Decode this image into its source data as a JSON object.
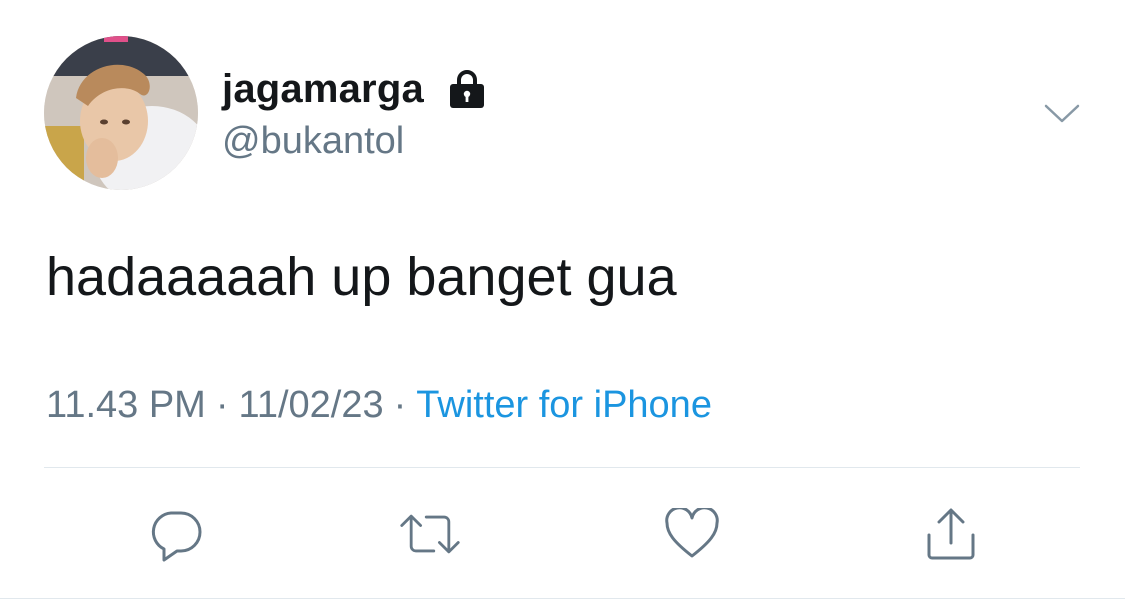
{
  "user": {
    "display_name": "jagamarga",
    "handle": "@bukantol",
    "avatar": "profile-photo",
    "protected_icon": "lock-icon"
  },
  "tweet": {
    "text": "hadaaaaah up banget gua"
  },
  "meta": {
    "time": "11.43 PM",
    "separator": "·",
    "date": "11/02/23",
    "source": "Twitter for iPhone"
  },
  "menu": {
    "icon": "chevron-down-icon"
  },
  "actions": {
    "reply_icon": "reply-icon",
    "retweet_icon": "retweet-icon",
    "like_icon": "heart-icon",
    "share_icon": "share-icon"
  },
  "colors": {
    "text_primary": "#14171a",
    "text_secondary": "#657786",
    "link": "#1b95e0",
    "divider": "#e1e8ed"
  }
}
